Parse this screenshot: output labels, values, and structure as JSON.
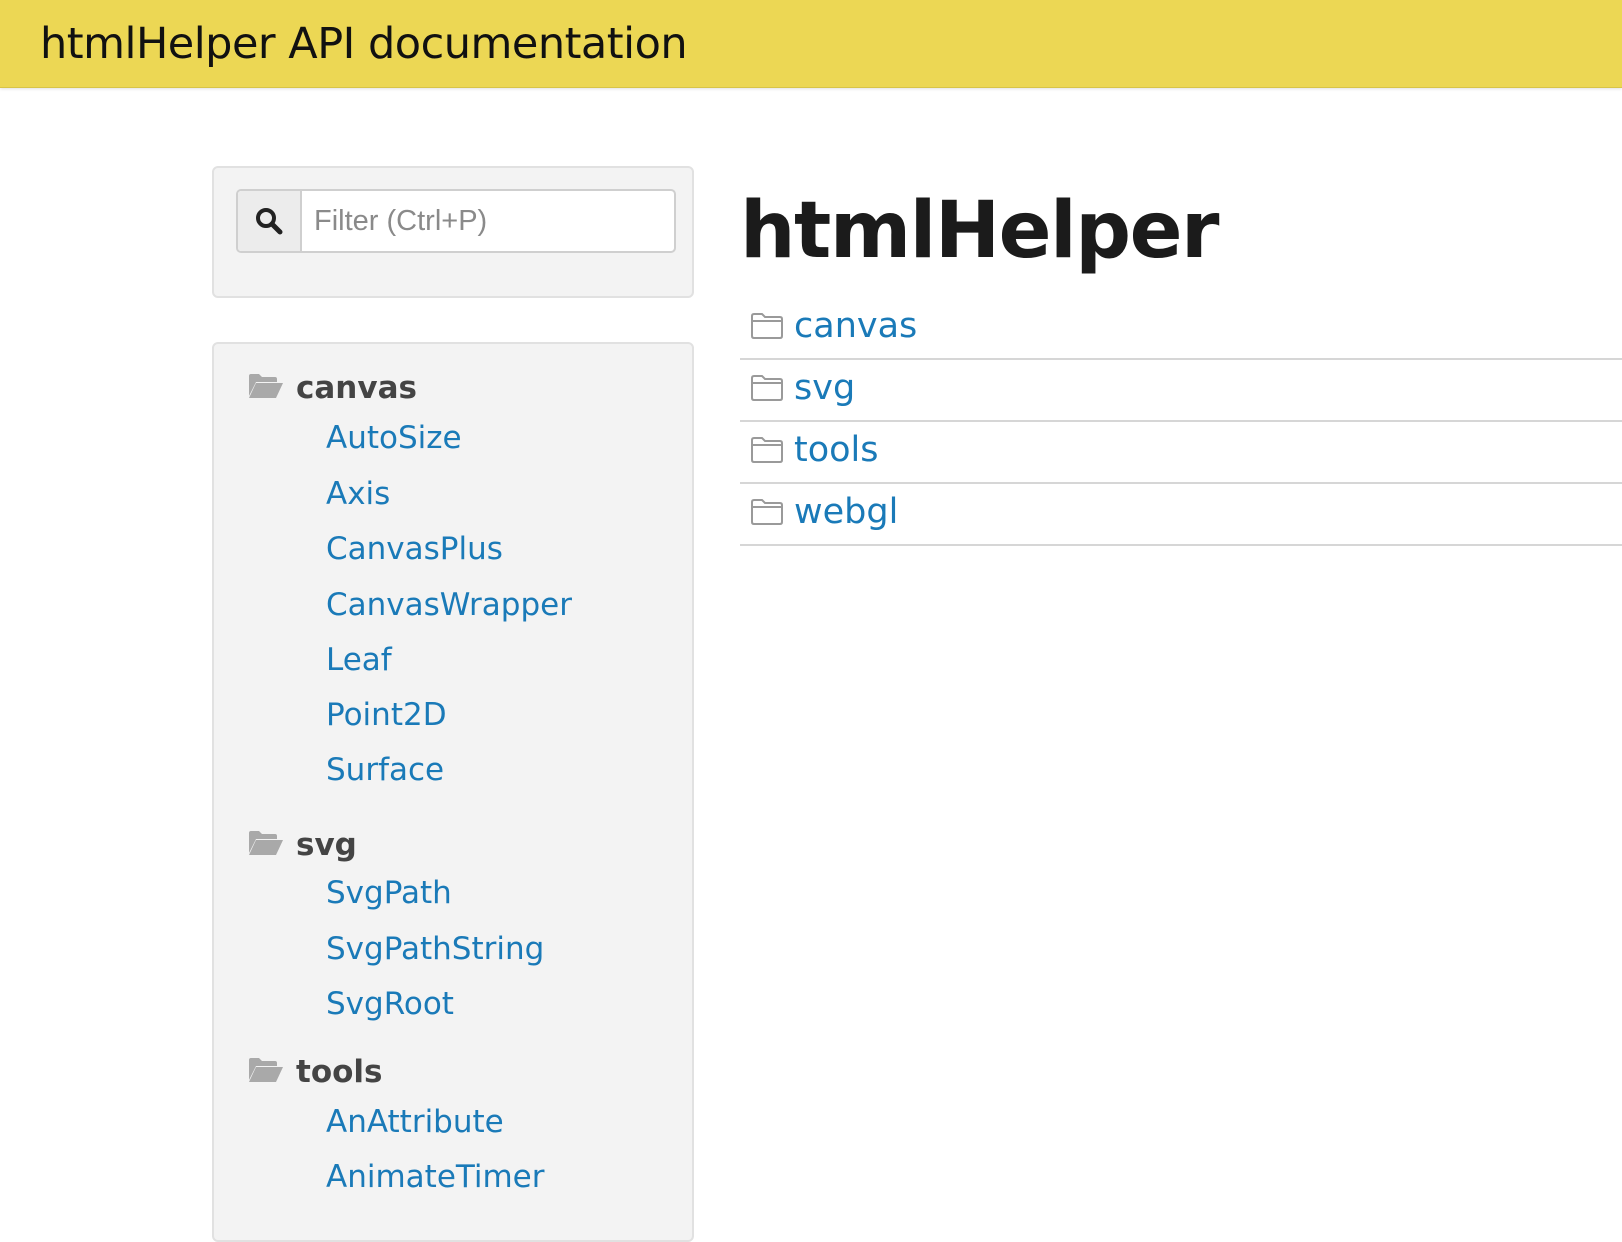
{
  "header": {
    "title": "htmlHelper API documentation"
  },
  "filter": {
    "placeholder": "Filter (Ctrl+P)",
    "value": ""
  },
  "nav": {
    "groups": [
      {
        "label": "canvas",
        "items": [
          "AutoSize",
          "Axis",
          "CanvasPlus",
          "CanvasWrapper",
          "Leaf",
          "Point2D",
          "Surface"
        ]
      },
      {
        "label": "svg",
        "items": [
          "SvgPath",
          "SvgPathString",
          "SvgRoot"
        ]
      },
      {
        "label": "tools",
        "items": [
          "AnAttribute",
          "AnimateTimer"
        ]
      }
    ]
  },
  "main": {
    "title": "htmlHelper",
    "folders": [
      "canvas",
      "svg",
      "tools",
      "webgl"
    ]
  },
  "colors": {
    "header_bg": "#ecd754",
    "link": "#1a7ab8",
    "panel_bg": "#f3f3f3"
  }
}
